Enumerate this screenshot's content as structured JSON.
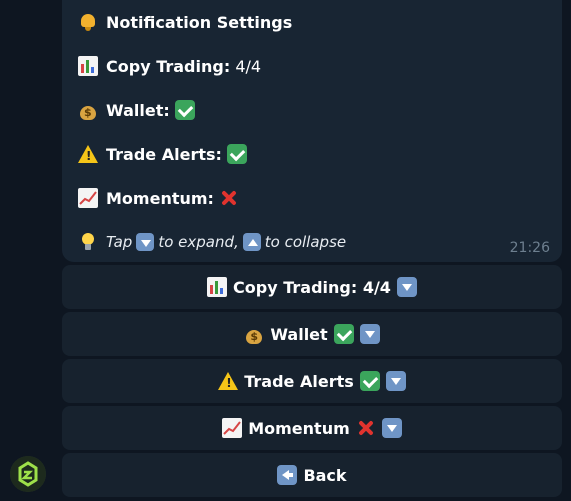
{
  "message": {
    "title": "Notification Settings",
    "lines": [
      {
        "label": "Copy Trading:",
        "value": "4/4"
      },
      {
        "label": "Wallet:"
      },
      {
        "label": "Trade Alerts:"
      },
      {
        "label": "Momentum:"
      }
    ],
    "tip": {
      "prefix": "Tap",
      "middle": "to expand,",
      "suffix": "to collapse"
    },
    "time": "21:26"
  },
  "keyboard": {
    "buttons": [
      {
        "label": "Copy Trading: 4/4"
      },
      {
        "label": "Wallet"
      },
      {
        "label": "Trade Alerts"
      },
      {
        "label": "Momentum"
      },
      {
        "label": "Back"
      }
    ]
  },
  "icons": {
    "title": "bell-icon",
    "copy_trading": "bar-chart-icon",
    "wallet": "money-bag-icon",
    "trade_alerts": "warning-icon",
    "momentum": "chart-increasing-icon",
    "tip": "light-bulb-icon",
    "enabled": "check-mark-icon",
    "disabled": "cross-mark-icon",
    "expand": "down-arrow-icon",
    "collapse": "up-arrow-icon",
    "back": "left-arrow-icon"
  },
  "colors": {
    "background": "#0e1621",
    "bubble": "#182533",
    "button": "#17222e",
    "check": "#3ba55c",
    "cross": "#e0332e",
    "arrow_box": "#6f95c6",
    "timestamp": "#6d7f8f"
  }
}
